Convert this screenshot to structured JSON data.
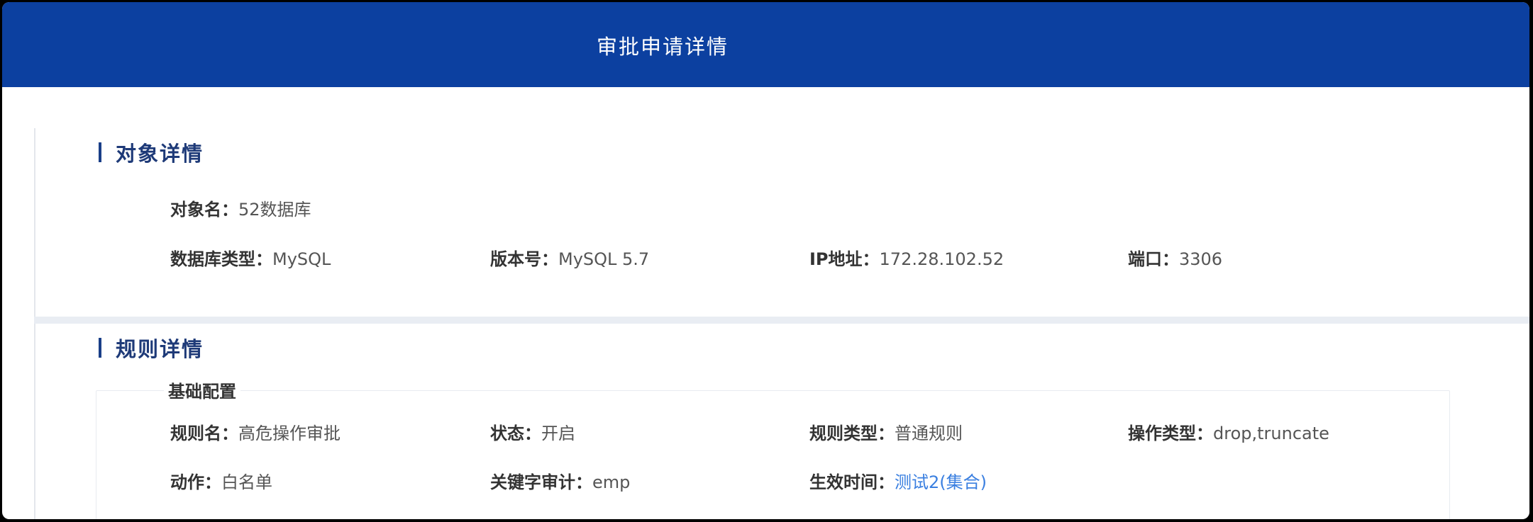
{
  "header": {
    "title": "审批申请详情"
  },
  "object_section": {
    "title": "对象详情",
    "fields": {
      "object_name": {
        "label": "对象名：",
        "value": "52数据库"
      },
      "db_type": {
        "label": "数据库类型：",
        "value": "MySQL"
      },
      "version": {
        "label": "版本号：",
        "value": "MySQL 5.7"
      },
      "ip": {
        "label": "IP地址：",
        "value": "172.28.102.52"
      },
      "port": {
        "label": "端口：",
        "value": "3306"
      }
    }
  },
  "rule_section": {
    "title": "规则详情",
    "group_title": "基础配置",
    "fields": {
      "rule_name": {
        "label": "规则名：",
        "value": "高危操作审批"
      },
      "status": {
        "label": "状态：",
        "value": "开启"
      },
      "rule_type": {
        "label": "规则类型：",
        "value": "普通规则"
      },
      "operation_type": {
        "label": "操作类型：",
        "value": "drop,truncate"
      },
      "action": {
        "label": "动作：",
        "value": "白名单"
      },
      "keyword_audit": {
        "label": "关键字审计：",
        "value": "emp"
      },
      "effective_time": {
        "label": "生效时间：",
        "value": "测试2(集合)"
      }
    }
  },
  "colors": {
    "header_bg": "#0c40a0",
    "section_title": "#1e3a78",
    "link": "#3a7fe0"
  }
}
